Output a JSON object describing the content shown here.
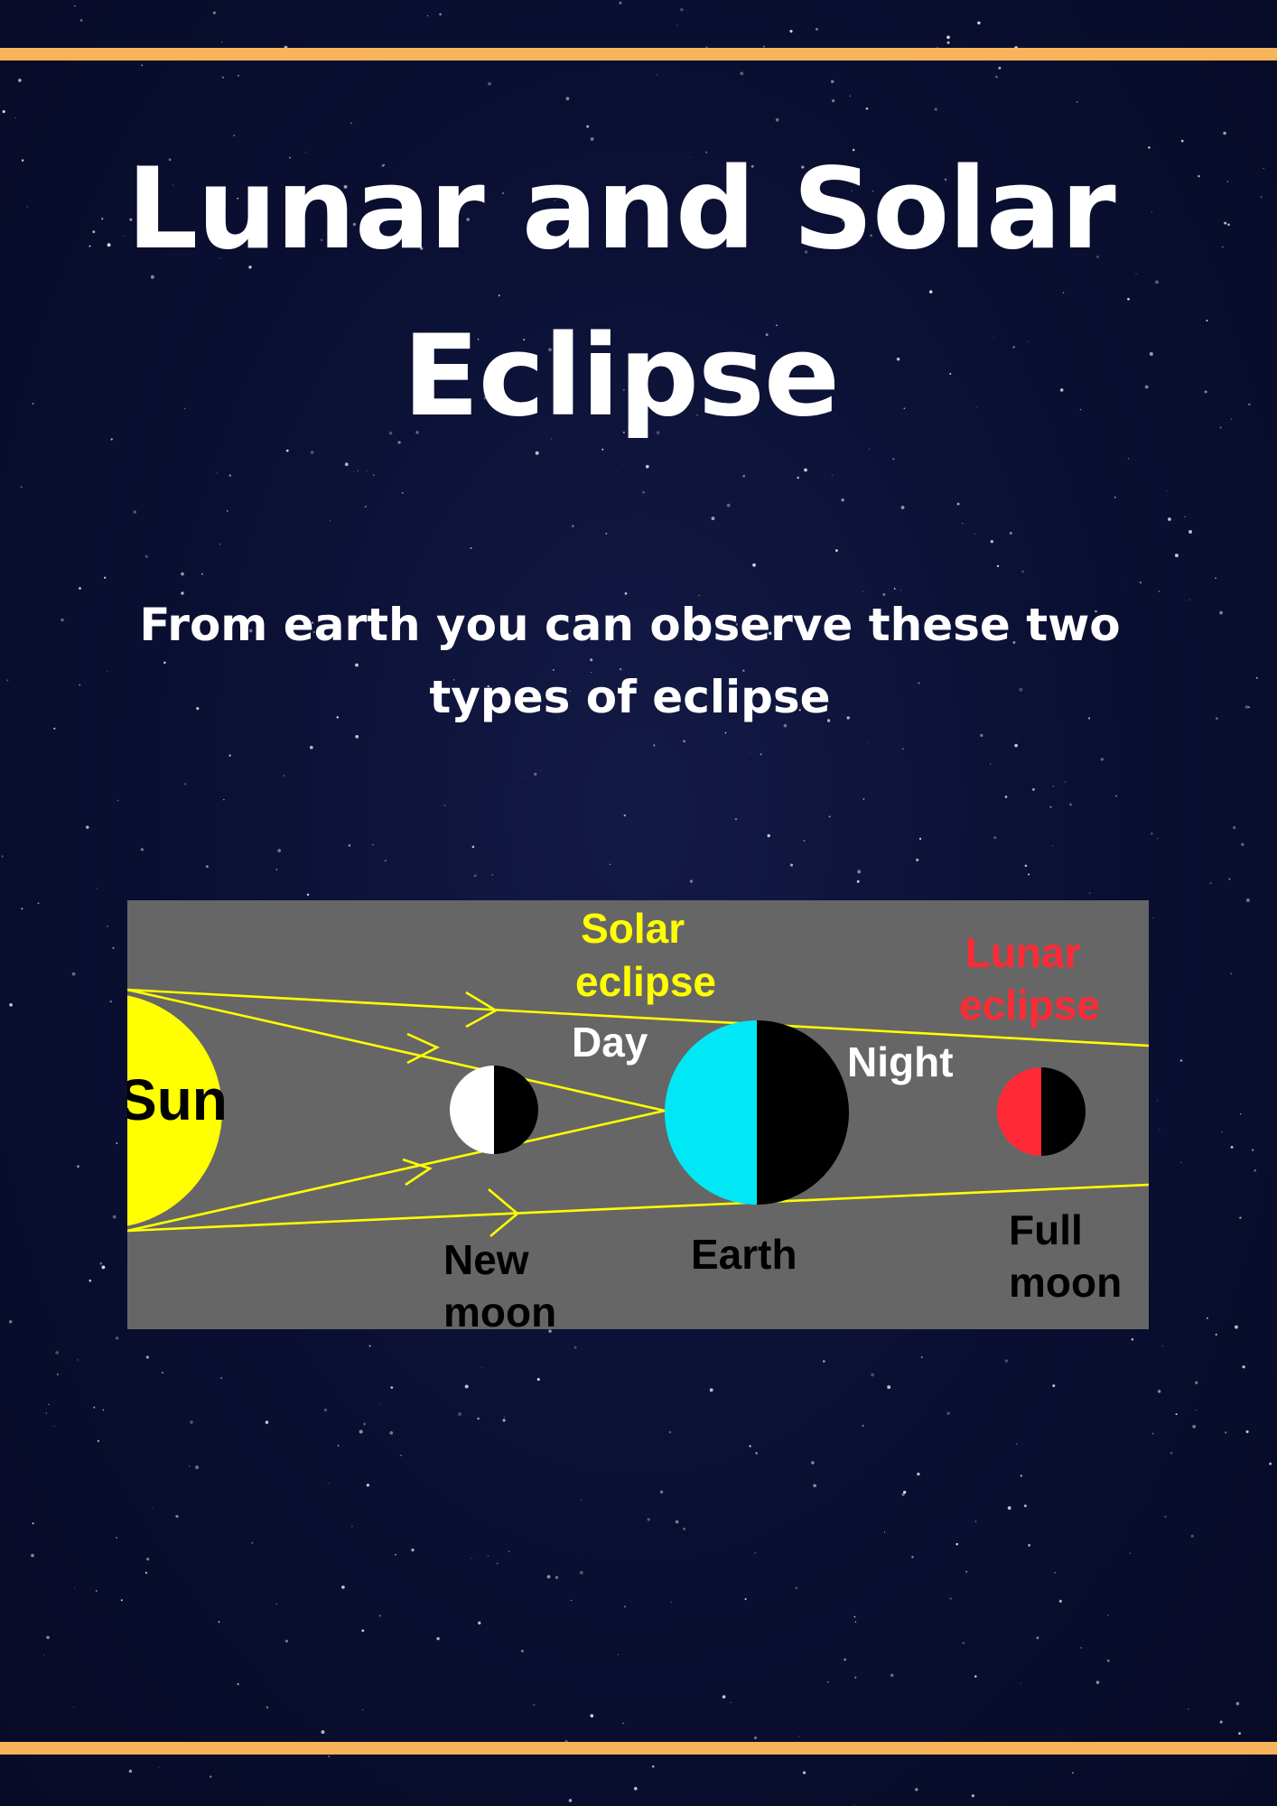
{
  "colors": {
    "background": "#0b1034",
    "accent_rule": "#f8b45a",
    "title_text": "#ffffff",
    "panel": "#666666",
    "sun": "#ffff00",
    "ray": "#ffff00",
    "earth_day": "#00e8f5",
    "lunar_moon": "#ff2a35",
    "solar_label": "#ffff00",
    "lunar_label": "#ff2a35",
    "dark_label": "#000000",
    "light_label": "#ffffff"
  },
  "poster": {
    "title": "Lunar and Solar Eclipse",
    "subtitle": "From earth you can observe these two types of eclipse"
  },
  "diagram": {
    "sun_label": "Sun",
    "solar_eclipse_label": [
      "Solar",
      "eclipse"
    ],
    "lunar_eclipse_label": [
      "Lunar",
      "eclipse"
    ],
    "day_label": "Day",
    "night_label": "Night",
    "new_moon_label": [
      "New",
      "moon"
    ],
    "earth_label": "Earth",
    "full_moon_label": [
      "Full",
      "moon"
    ]
  }
}
